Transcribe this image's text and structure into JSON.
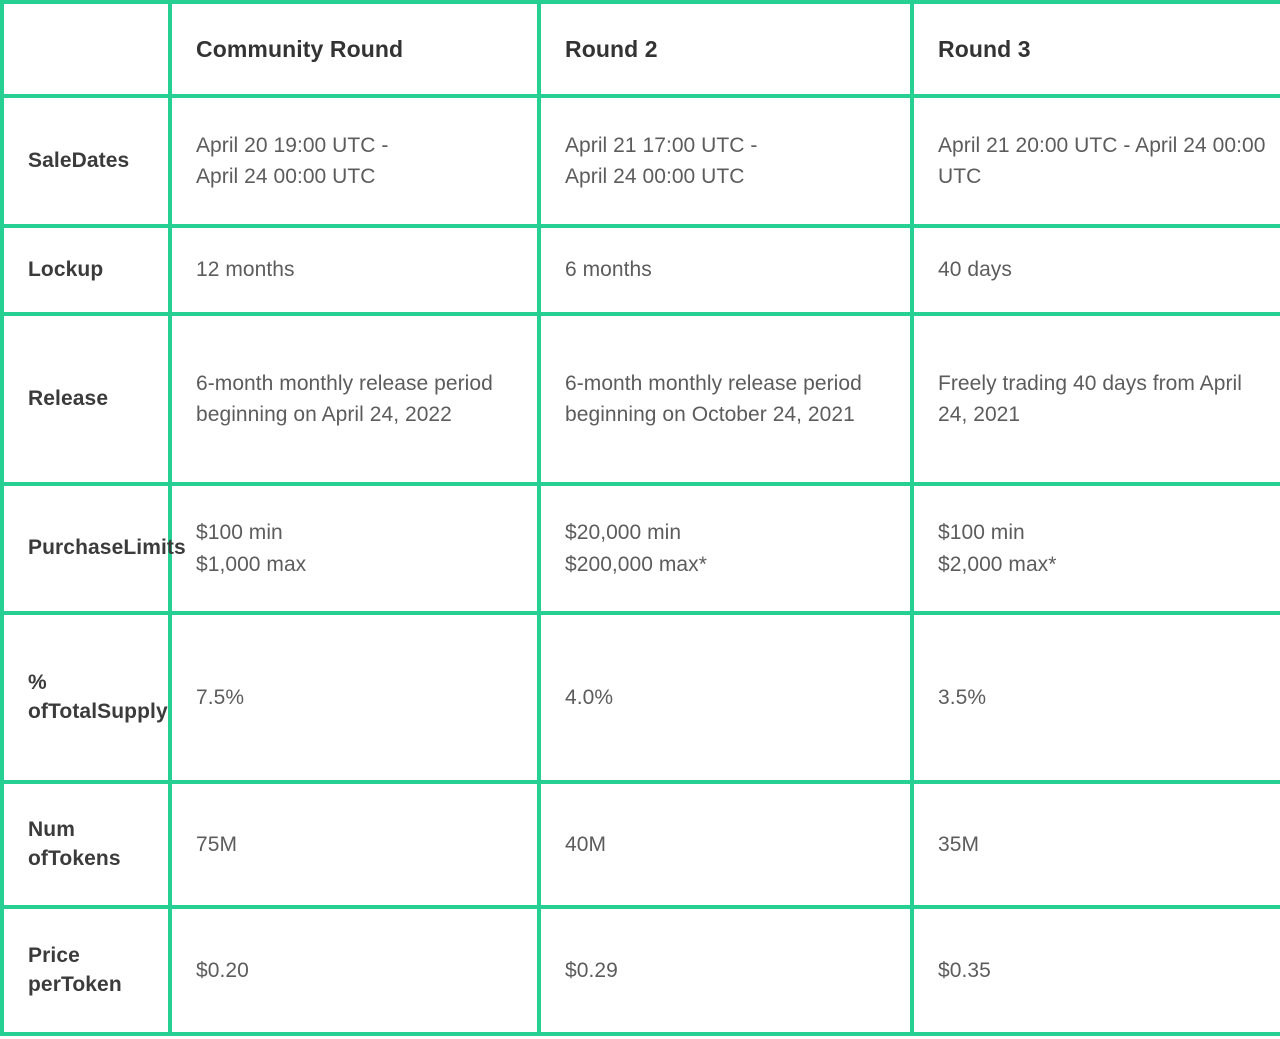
{
  "table": {
    "accent_color": "#26cf92",
    "header_text_color": "#333333",
    "row_header_text_color": "#3b3b3b",
    "body_text_color": "#5c5c5c",
    "corner_label": "",
    "columns": [
      {
        "key": "label",
        "label": ""
      },
      {
        "key": "round1",
        "label": "Community Round"
      },
      {
        "key": "round2",
        "label": "Round 2"
      },
      {
        "key": "round3",
        "label": "Round 3"
      }
    ],
    "rows": [
      {
        "key": "sale-dates",
        "header_lines": [
          "Sale",
          "Dates"
        ],
        "cells": [
          [
            "April 20 19:00 UTC -",
            "April 24 00:00 UTC"
          ],
          [
            "April 21 17:00 UTC -",
            "April 24 00:00 UTC"
          ],
          [
            "April 21 20:00 UTC - April 24 00:00 UTC"
          ]
        ]
      },
      {
        "key": "lockup",
        "header_lines": [
          "Lockup"
        ],
        "cells": [
          [
            "12 months"
          ],
          [
            "6 months"
          ],
          [
            "40 days"
          ]
        ]
      },
      {
        "key": "release",
        "header_lines": [
          "Release"
        ],
        "cells": [
          [
            "6-month monthly release period beginning on April 24, 2022"
          ],
          [
            "6-month monthly release period beginning on October 24, 2021"
          ],
          [
            "Freely trading 40 days from April 24, 2021"
          ]
        ]
      },
      {
        "key": "limits",
        "header_lines": [
          "Purchase",
          "Limits"
        ],
        "cells": [
          [
            "$100 min",
            "$1,000 max"
          ],
          [
            "$20,000 min",
            "$200,000 max*"
          ],
          [
            "$100 min",
            "$2,000 max*"
          ]
        ]
      },
      {
        "key": "supply",
        "header_lines": [
          "% of",
          "Total",
          "Supply"
        ],
        "cells": [
          [
            "7.5%"
          ],
          [
            "4.0%"
          ],
          [
            "3.5%"
          ]
        ]
      },
      {
        "key": "num-tokens",
        "header_lines": [
          "Num of",
          "Tokens"
        ],
        "cells": [
          [
            "75M"
          ],
          [
            "40M"
          ],
          [
            "35M"
          ]
        ]
      },
      {
        "key": "price",
        "header_lines": [
          "Price per",
          "Token"
        ],
        "cells": [
          [
            "$0.20"
          ],
          [
            "$0.29"
          ],
          [
            "$0.35"
          ]
        ]
      }
    ]
  }
}
